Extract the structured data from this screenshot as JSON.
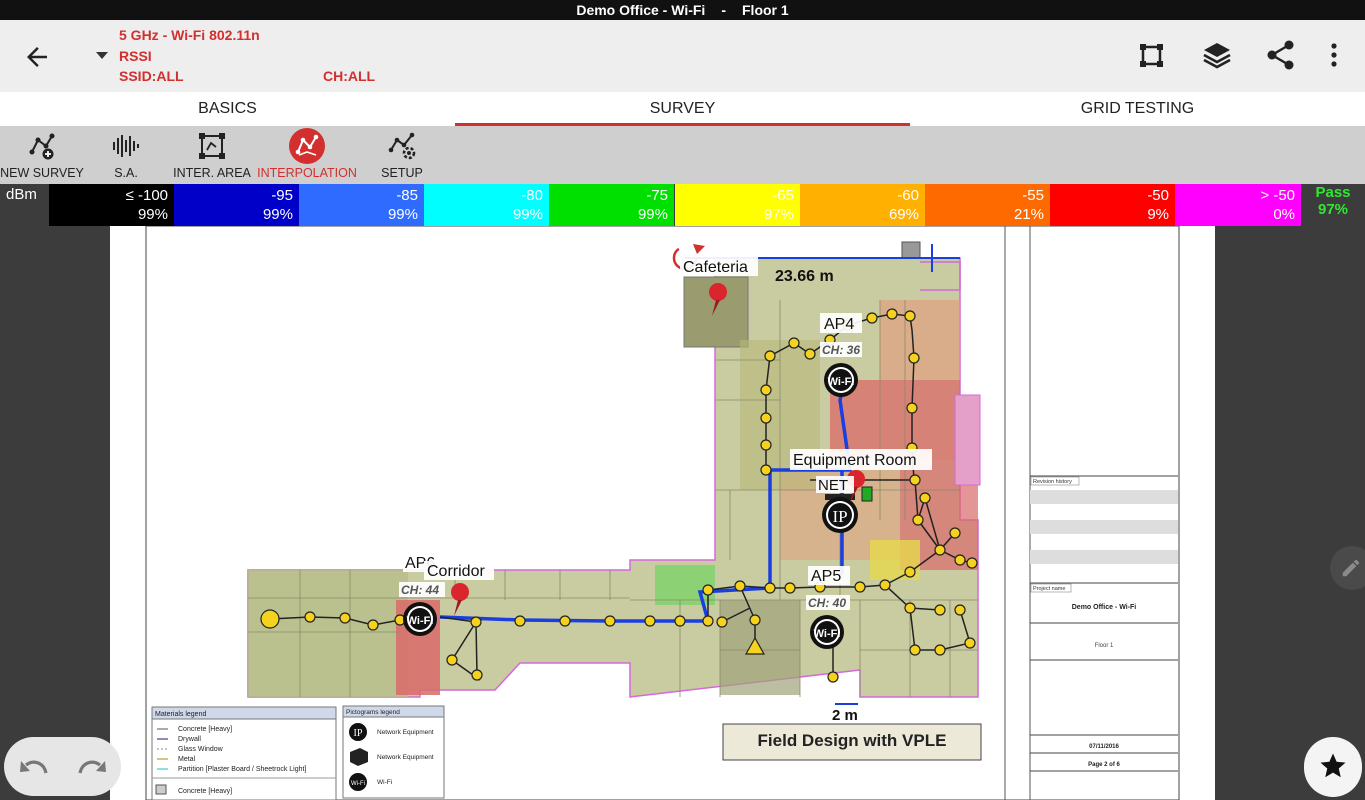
{
  "window_title": "Demo Office - Wi-Fi",
  "window_sep": "-",
  "floor_title": "Floor 1",
  "header": {
    "band": "5 GHz - Wi-Fi 802.11n",
    "metric": "RSSI",
    "ssid": "SSID:ALL",
    "channel": "CH:ALL"
  },
  "tabs": [
    {
      "label": "BASICS",
      "active": false
    },
    {
      "label": "SURVEY",
      "active": true
    },
    {
      "label": "GRID TESTING",
      "active": false
    }
  ],
  "tools": [
    {
      "label": "NEW SURVEY",
      "icon": "new-survey-icon"
    },
    {
      "label": "S.A.",
      "icon": "spectrum-analyzer-icon"
    },
    {
      "label": "INTER. AREA",
      "icon": "inter-area-icon"
    },
    {
      "label": "INTERPOLATION",
      "icon": "interpolation-icon",
      "active": true
    },
    {
      "label": "SETUP",
      "icon": "setup-icon"
    }
  ],
  "legend": {
    "unit": "dBm",
    "pass_label": "Pass",
    "pass_value": "97%",
    "cells": [
      {
        "dbm": "≤ -100",
        "pct": "99%",
        "color": "#000000",
        "text": "#ffffff"
      },
      {
        "dbm": "-95",
        "pct": "99%",
        "color": "#0000c8",
        "text": "#ffffff"
      },
      {
        "dbm": "-85",
        "pct": "99%",
        "color": "#2f6bff",
        "text": "#ffffff"
      },
      {
        "dbm": "-80",
        "pct": "99%",
        "color": "#00ffff",
        "text": "#ffffff"
      },
      {
        "dbm": "-75",
        "pct": "99%",
        "color": "#00e000",
        "text": "#ffffff"
      },
      {
        "dbm": "-65",
        "pct": "97%",
        "color": "#ffff00",
        "text": "#ffffff"
      },
      {
        "dbm": "-60",
        "pct": "69%",
        "color": "#ffb000",
        "text": "#ffffff"
      },
      {
        "dbm": "-55",
        "pct": "21%",
        "color": "#ff6a00",
        "text": "#ffffff"
      },
      {
        "dbm": "-50",
        "pct": "9%",
        "color": "#ff0000",
        "text": "#ffffff"
      },
      {
        "dbm": "> -50",
        "pct": "0%",
        "color": "#ff00ff",
        "text": "#ffffff"
      }
    ]
  },
  "map": {
    "cafeteria": "Cafeteria",
    "distance_top": "23.66 m",
    "ap4": "AP4",
    "ap4_ch": "CH: 36",
    "equipment_room": "Equipment Room",
    "net": "NET",
    "ap5": "AP5",
    "ap5_ch": "CH: 40",
    "ap6": "AP6",
    "ap6_ch": "CH: 44",
    "corridor": "Corridor",
    "distance_bottom": "2 m",
    "field_design": "Field Design with VPLE",
    "wifi_glyph": "Wi-Fi",
    "ip_glyph": "IP"
  },
  "title_block": {
    "revision_history": "Revision history",
    "project_name": "Project name",
    "project_value": "Demo Office - Wi-Fi",
    "floor": "Floor 1",
    "date": "07/11/2016",
    "page": "Page 2 of 6"
  },
  "materials_legend": {
    "title": "Materials legend",
    "items": [
      "Concrete [Heavy]",
      "Drywall",
      "Glass Window",
      "Metal",
      "Partition [Plaster Board / Sheetrock Light]"
    ],
    "bottom_item": "Concrete [Heavy]"
  },
  "pictograms_legend": {
    "title": "Pictograms legend",
    "items": [
      "Network Equipment",
      "Network Equipment",
      "Wi-Fi"
    ]
  },
  "colors": {
    "accent": "#d32f2f",
    "survey_path": "#1a3fe0",
    "point": "#f5d21e",
    "pass": "#2ee82e"
  }
}
